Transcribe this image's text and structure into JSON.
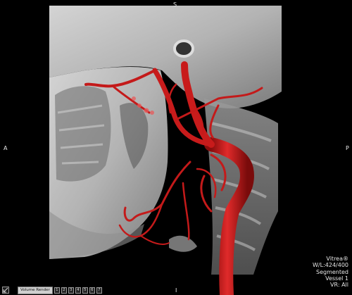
{
  "orientation": {
    "top": "S",
    "left": "A",
    "right": "P",
    "bottom": "I"
  },
  "info_overlay": {
    "lines": [
      "Vitrea®",
      "W/L:424/400",
      "Segmented",
      "Vessel 1",
      "VR: All"
    ]
  },
  "toolbar": {
    "mode_label": "Volume Render",
    "buttons": [
      "1",
      "2",
      "3",
      "4",
      "5",
      "6",
      "7"
    ]
  },
  "colors": {
    "vessel": "#cc1c1c",
    "bone": "#b9b9b9",
    "background": "#000000"
  }
}
